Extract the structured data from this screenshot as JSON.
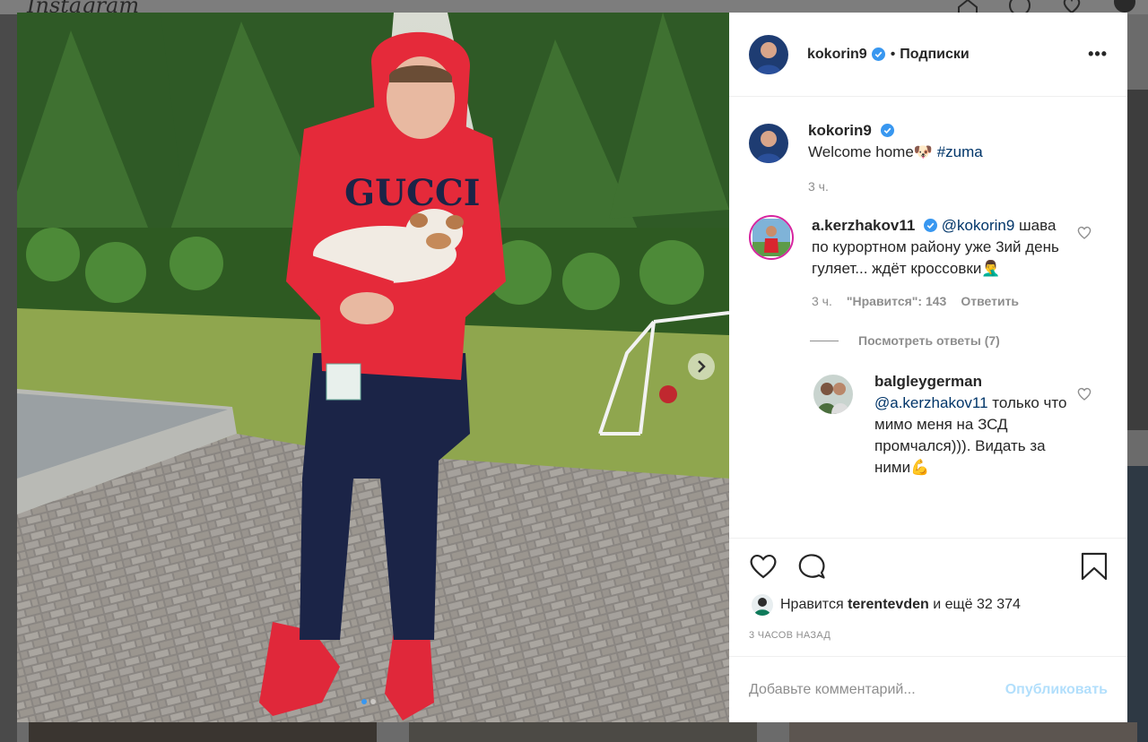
{
  "background": {
    "logo": "Instagram"
  },
  "post": {
    "author": "kokorin9",
    "follow_status": "Подписки",
    "separator": "•",
    "more": "•••",
    "caption": {
      "user": "kokorin9",
      "text": "Welcome home",
      "emoji": "🐶",
      "hashtag": "#zuma",
      "time": "3 ч."
    },
    "comment": {
      "user": "a.kerzhakov11",
      "mention": "@kokorin9",
      "text": "шава по курортном району уже 3ий день гуляет... ждёт кроссовки",
      "emoji": "🤦‍♂️",
      "time": "3 ч.",
      "likes": "\"Нравится\": 143",
      "reply_label": "Ответить"
    },
    "view_replies": "Посмотреть ответы (7)",
    "reply": {
      "user": "balgleygerman",
      "mention": "@a.kerzhakov11",
      "text": "только что мимо меня на ЗСД промчался))). Видать за ними",
      "emoji": "💪"
    },
    "likes": {
      "prefix": "Нравится",
      "user": "terentevden",
      "suffix": "и ещё 32 374"
    },
    "posted": "3 ЧАСОВ НАЗАД",
    "comment_placeholder": "Добавьте комментарий...",
    "publish_label": "Опубликовать"
  },
  "colors": {
    "verified": "#3897f0",
    "link": "#003569",
    "muted": "#8e8e8e",
    "publish_disabled": "#b2dffc"
  },
  "carousel": {
    "total": 2,
    "current": 1
  }
}
